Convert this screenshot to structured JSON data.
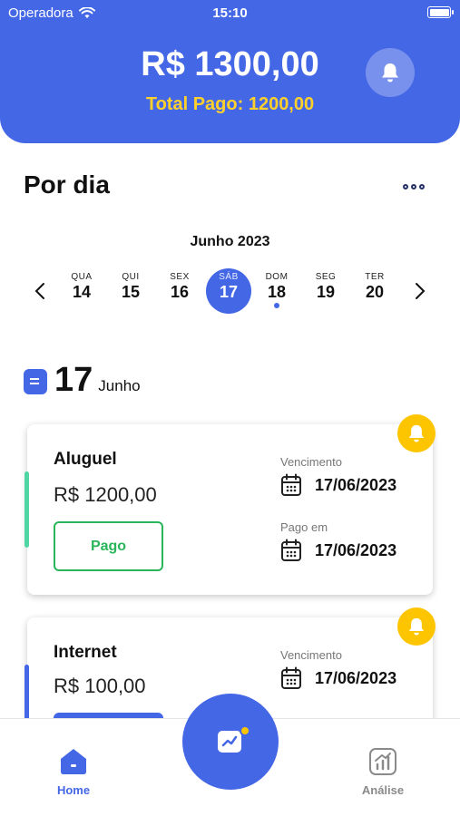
{
  "status_bar": {
    "carrier": "Operadora",
    "time": "15:10",
    "battery_level": 1.0
  },
  "header": {
    "balance": "R$ 1300,00",
    "total_paid": "Total Pago: 1200,00",
    "bell_icon": "bell-icon"
  },
  "section": {
    "title": "Por dia",
    "more_icon": "ellipsis-icon"
  },
  "calendar": {
    "month": "Junho 2023",
    "days": [
      {
        "dow": "QUA",
        "num": "14"
      },
      {
        "dow": "QUI",
        "num": "15"
      },
      {
        "dow": "SEX",
        "num": "16"
      },
      {
        "dow": "SÁB",
        "num": "17",
        "selected": true
      },
      {
        "dow": "DOM",
        "num": "18",
        "has_event": true
      },
      {
        "dow": "SEG",
        "num": "19"
      },
      {
        "dow": "TER",
        "num": "20"
      }
    ]
  },
  "date_header": {
    "day": "17",
    "month": "Junho"
  },
  "bills": [
    {
      "name": "Aluguel",
      "amount": "R$ 1200,00",
      "status": "Pago",
      "due_label": "Vencimento",
      "due_date": "17/06/2023",
      "paid_label": "Pago em",
      "paid_date": "17/06/2023",
      "accent": "#4fd6a4"
    },
    {
      "name": "Internet",
      "amount": "R$ 100,00",
      "due_label": "Vencimento",
      "due_date": "17/06/2023",
      "accent": "#4467e6"
    }
  ],
  "tabbar": {
    "home": "Home",
    "analysis": "Análise"
  },
  "colors": {
    "primary": "#4467e6",
    "accent_yellow": "#fdc500",
    "paid_green": "#2bb55a"
  }
}
